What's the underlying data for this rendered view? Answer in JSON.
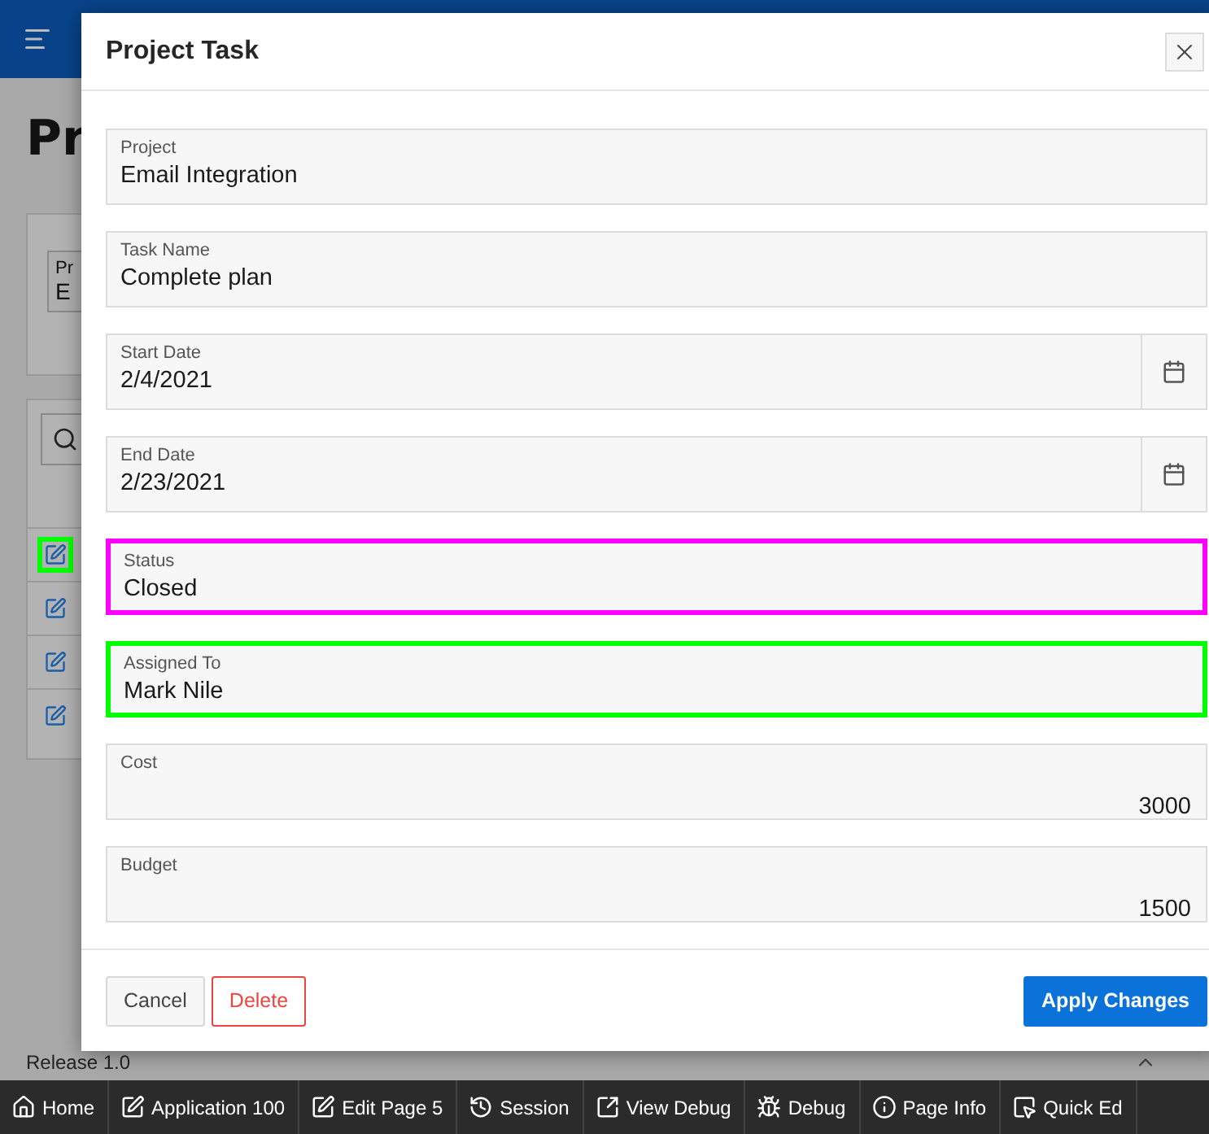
{
  "background_page": {
    "title": "Pr",
    "region_label": "Pr",
    "region_value": "E",
    "row_edit_icons": [
      {
        "highlighted": true,
        "color": "#00ff00"
      },
      {
        "highlighted": false
      },
      {
        "highlighted": false
      },
      {
        "highlighted": false
      }
    ],
    "footer": "Release 1.0"
  },
  "dialog": {
    "title": "Project Task",
    "fields": [
      {
        "kind": "text",
        "label": "Project",
        "value": "Email Integration"
      },
      {
        "kind": "text",
        "label": "Task Name",
        "value": "Complete plan"
      },
      {
        "kind": "date",
        "label": "Start Date",
        "value": "2/4/2021"
      },
      {
        "kind": "date",
        "label": "End Date",
        "value": "2/23/2021"
      },
      {
        "kind": "text",
        "label": "Status",
        "value": "Closed",
        "color": "#ff00ff"
      },
      {
        "kind": "text",
        "label": "Assigned To",
        "value": "Mark Nile",
        "color": "#00ff00"
      },
      {
        "kind": "number",
        "label": "Cost",
        "value": "3000"
      },
      {
        "kind": "number",
        "label": "Budget",
        "value": "1500"
      }
    ],
    "buttons": [
      {
        "kind": "plain",
        "label": "Cancel"
      },
      {
        "kind": "danger",
        "label": "Delete"
      },
      {
        "kind": "primary",
        "label": "Apply Changes"
      }
    ]
  },
  "dev_toolbar": [
    {
      "label": "Home"
    },
    {
      "label": "Application 100"
    },
    {
      "label": "Edit Page 5"
    },
    {
      "label": "Session"
    },
    {
      "label": "View Debug"
    },
    {
      "label": "Debug"
    },
    {
      "label": "Page Info"
    },
    {
      "label": "Quick Ed"
    }
  ]
}
